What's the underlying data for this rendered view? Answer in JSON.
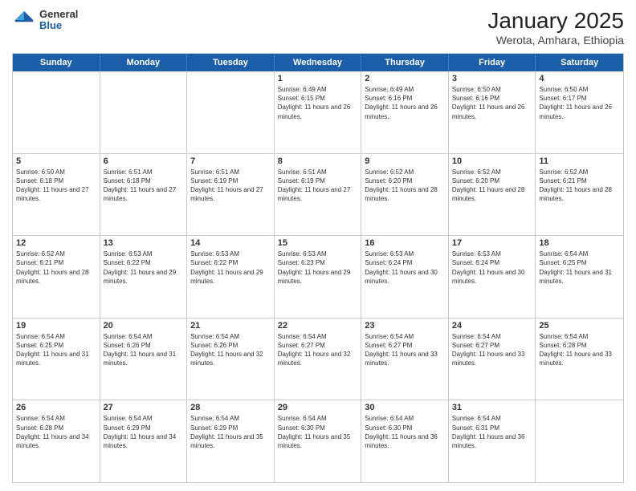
{
  "header": {
    "logo": {
      "general": "General",
      "blue": "Blue"
    },
    "title": "January 2025",
    "subtitle": "Werota, Amhara, Ethiopia"
  },
  "weekdays": [
    "Sunday",
    "Monday",
    "Tuesday",
    "Wednesday",
    "Thursday",
    "Friday",
    "Saturday"
  ],
  "weeks": [
    [
      {
        "day": "",
        "info": ""
      },
      {
        "day": "",
        "info": ""
      },
      {
        "day": "",
        "info": ""
      },
      {
        "day": "1",
        "info": "Sunrise: 6:49 AM\nSunset: 6:15 PM\nDaylight: 11 hours and 26 minutes."
      },
      {
        "day": "2",
        "info": "Sunrise: 6:49 AM\nSunset: 6:16 PM\nDaylight: 11 hours and 26 minutes."
      },
      {
        "day": "3",
        "info": "Sunrise: 6:50 AM\nSunset: 6:16 PM\nDaylight: 11 hours and 26 minutes."
      },
      {
        "day": "4",
        "info": "Sunrise: 6:50 AM\nSunset: 6:17 PM\nDaylight: 11 hours and 26 minutes."
      }
    ],
    [
      {
        "day": "5",
        "info": "Sunrise: 6:50 AM\nSunset: 6:18 PM\nDaylight: 11 hours and 27 minutes."
      },
      {
        "day": "6",
        "info": "Sunrise: 6:51 AM\nSunset: 6:18 PM\nDaylight: 11 hours and 27 minutes."
      },
      {
        "day": "7",
        "info": "Sunrise: 6:51 AM\nSunset: 6:19 PM\nDaylight: 11 hours and 27 minutes."
      },
      {
        "day": "8",
        "info": "Sunrise: 6:51 AM\nSunset: 6:19 PM\nDaylight: 11 hours and 27 minutes."
      },
      {
        "day": "9",
        "info": "Sunrise: 6:52 AM\nSunset: 6:20 PM\nDaylight: 11 hours and 28 minutes."
      },
      {
        "day": "10",
        "info": "Sunrise: 6:52 AM\nSunset: 6:20 PM\nDaylight: 11 hours and 28 minutes."
      },
      {
        "day": "11",
        "info": "Sunrise: 6:52 AM\nSunset: 6:21 PM\nDaylight: 11 hours and 28 minutes."
      }
    ],
    [
      {
        "day": "12",
        "info": "Sunrise: 6:52 AM\nSunset: 6:21 PM\nDaylight: 11 hours and 28 minutes."
      },
      {
        "day": "13",
        "info": "Sunrise: 6:53 AM\nSunset: 6:22 PM\nDaylight: 11 hours and 29 minutes."
      },
      {
        "day": "14",
        "info": "Sunrise: 6:53 AM\nSunset: 6:22 PM\nDaylight: 11 hours and 29 minutes."
      },
      {
        "day": "15",
        "info": "Sunrise: 6:53 AM\nSunset: 6:23 PM\nDaylight: 11 hours and 29 minutes."
      },
      {
        "day": "16",
        "info": "Sunrise: 6:53 AM\nSunset: 6:24 PM\nDaylight: 11 hours and 30 minutes."
      },
      {
        "day": "17",
        "info": "Sunrise: 6:53 AM\nSunset: 6:24 PM\nDaylight: 11 hours and 30 minutes."
      },
      {
        "day": "18",
        "info": "Sunrise: 6:54 AM\nSunset: 6:25 PM\nDaylight: 11 hours and 31 minutes."
      }
    ],
    [
      {
        "day": "19",
        "info": "Sunrise: 6:54 AM\nSunset: 6:25 PM\nDaylight: 11 hours and 31 minutes."
      },
      {
        "day": "20",
        "info": "Sunrise: 6:54 AM\nSunset: 6:26 PM\nDaylight: 11 hours and 31 minutes."
      },
      {
        "day": "21",
        "info": "Sunrise: 6:54 AM\nSunset: 6:26 PM\nDaylight: 11 hours and 32 minutes."
      },
      {
        "day": "22",
        "info": "Sunrise: 6:54 AM\nSunset: 6:27 PM\nDaylight: 11 hours and 32 minutes."
      },
      {
        "day": "23",
        "info": "Sunrise: 6:54 AM\nSunset: 6:27 PM\nDaylight: 11 hours and 33 minutes."
      },
      {
        "day": "24",
        "info": "Sunrise: 6:54 AM\nSunset: 6:27 PM\nDaylight: 11 hours and 33 minutes."
      },
      {
        "day": "25",
        "info": "Sunrise: 6:54 AM\nSunset: 6:28 PM\nDaylight: 11 hours and 33 minutes."
      }
    ],
    [
      {
        "day": "26",
        "info": "Sunrise: 6:54 AM\nSunset: 6:28 PM\nDaylight: 11 hours and 34 minutes."
      },
      {
        "day": "27",
        "info": "Sunrise: 6:54 AM\nSunset: 6:29 PM\nDaylight: 11 hours and 34 minutes."
      },
      {
        "day": "28",
        "info": "Sunrise: 6:54 AM\nSunset: 6:29 PM\nDaylight: 11 hours and 35 minutes."
      },
      {
        "day": "29",
        "info": "Sunrise: 6:54 AM\nSunset: 6:30 PM\nDaylight: 11 hours and 35 minutes."
      },
      {
        "day": "30",
        "info": "Sunrise: 6:54 AM\nSunset: 6:30 PM\nDaylight: 11 hours and 36 minutes."
      },
      {
        "day": "31",
        "info": "Sunrise: 6:54 AM\nSunset: 6:31 PM\nDaylight: 11 hours and 36 minutes."
      },
      {
        "day": "",
        "info": ""
      }
    ]
  ]
}
